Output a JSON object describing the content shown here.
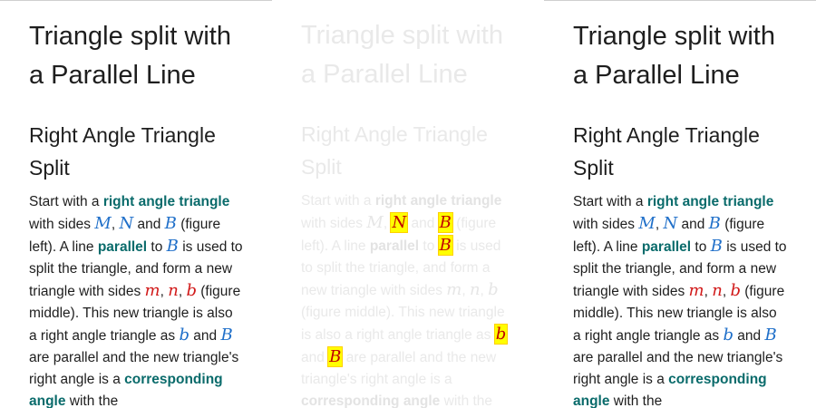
{
  "title": "Triangle split with a Parallel Line",
  "subtitle": "Right Angle Triangle Split",
  "paragraph": {
    "t1": "Start with a ",
    "k1": "right angle triangle",
    "t2": " with sides ",
    "M": "M",
    "c1": ", ",
    "N": "N",
    "t3": " and ",
    "B": "B",
    "t4": " (figure left). A line ",
    "k2": "parallel",
    "t5": " to ",
    "t6": " is used to split the triangle, and form a new triangle with sides ",
    "m": "m",
    "c2": ", ",
    "n": "n",
    "c3": ", ",
    "b": "b",
    "t7": " (figure middle). This new triangle is also a right angle triangle as ",
    "t8": " and ",
    "t9": " are parallel and the new triangle's right angle is a ",
    "k3": "corresponding angle",
    "t10": " with the"
  },
  "colors": {
    "keyword": "#0a6b6b",
    "math_blue": "#1f6fc9",
    "math_red": "#d11a1a",
    "highlight": "#ffff00"
  }
}
